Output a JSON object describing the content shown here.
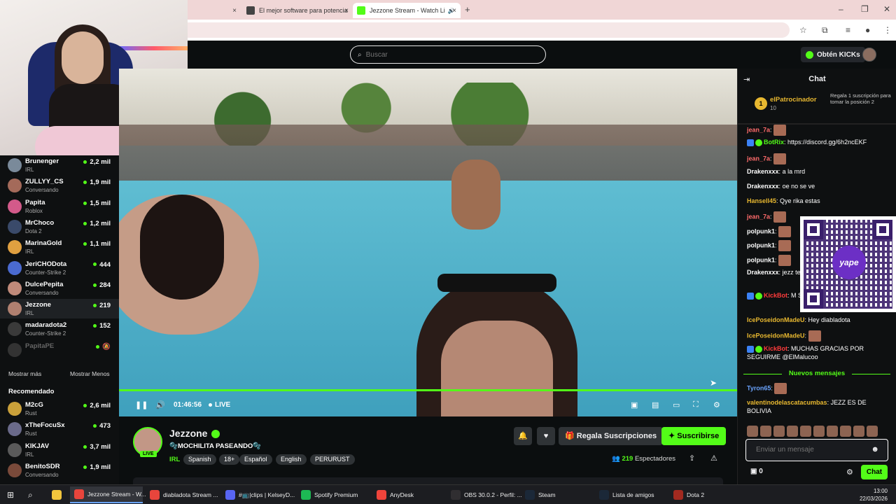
{
  "browser": {
    "tabs": [
      {
        "label": "",
        "active": false
      },
      {
        "label": "El mejor software para potencia",
        "active": false
      },
      {
        "label": "Jezzone Stream - Watch Li",
        "active": true
      }
    ],
    "new_tab": "+",
    "close": "×"
  },
  "header": {
    "search_placeholder": "Buscar",
    "get_kicks": "Obtén KICKs"
  },
  "sidebar": {
    "channels": [
      {
        "name": "Brunenger",
        "category": "IRL",
        "viewers": "2,2 mil",
        "color": "#7a8a9a"
      },
      {
        "name": "ZULLYY_CS",
        "category": "Conversando",
        "viewers": "1,9 mil",
        "color": "#a46a5a"
      },
      {
        "name": "Papita",
        "category": "Roblox",
        "viewers": "1,5 mil",
        "color": "#d35a8a"
      },
      {
        "name": "MrChoco",
        "category": "Dota 2",
        "viewers": "1,2 mil",
        "color": "#3a4a6a"
      },
      {
        "name": "MarinaGold",
        "category": "IRL",
        "viewers": "1,1 mil",
        "color": "#e0a040"
      },
      {
        "name": "JeriCHODota",
        "category": "Counter-Strike 2",
        "viewers": "444",
        "color": "#4a6ad0"
      },
      {
        "name": "DulcePepita",
        "category": "Conversando",
        "viewers": "284",
        "color": "#c08a7a"
      },
      {
        "name": "Jezzone",
        "category": "IRL",
        "viewers": "219",
        "color": "#b08070"
      },
      {
        "name": "madaradota2",
        "category": "Counter-Strike 2",
        "viewers": "152",
        "color": "#3a3a3a"
      },
      {
        "name": "PapitaPE",
        "category": "",
        "viewers": "",
        "color": "#333"
      }
    ],
    "show_more": "Mostrar más",
    "show_less": "Mostrar Menos",
    "recommended_title": "Recomendado",
    "recommended": [
      {
        "name": "M2cG",
        "category": "Rust",
        "viewers": "2,6 mil",
        "color": "#c9a03a"
      },
      {
        "name": "xTheFocuSx",
        "category": "Rust",
        "viewers": "473",
        "color": "#6a6a8a"
      },
      {
        "name": "KIKJAV",
        "category": "IRL",
        "viewers": "3,7 mil",
        "color": "#5a5a5a"
      },
      {
        "name": "BenitoSDR",
        "category": "Conversando",
        "viewers": "1,9 mil",
        "color": "#7a4a3a"
      }
    ]
  },
  "player": {
    "time": "01:46:56",
    "live": "LIVE"
  },
  "stream": {
    "name": "Jezzone",
    "live_tag": "LIVE",
    "title": "🫧MOCHILITA PASEANDO🫧",
    "category": "IRL",
    "tags": [
      "Spanish",
      "18+",
      "Español",
      "English",
      "PERURUST"
    ],
    "gift_label": "Regala Suscripciones",
    "subscribe_label": "Suscribirse",
    "viewers": "219",
    "viewers_label": "Espectadores"
  },
  "chat": {
    "title": "Chat",
    "pinned": {
      "rank": "1",
      "name": "elPatrocinador",
      "count": "10",
      "text": "Regala 1 suscripción para tomar la posición 2"
    },
    "messages": [
      {
        "user": "jean_7a",
        "text": "",
        "color": "#ff6b6b",
        "emote": true
      },
      {
        "user": "BotRix",
        "text": "https://discord.gg/6h2ncEKF",
        "color": "#53fc18",
        "badges": true
      },
      {
        "user": "jean_7a",
        "text": "",
        "color": "#ff6b6b",
        "emote": true
      },
      {
        "user": "Drakenxxx",
        "text": "a la mrd",
        "color": "#ffffff"
      },
      {
        "user": "Drakenxxx",
        "text": "oe no se ve",
        "color": "#ffffff"
      },
      {
        "user": "Hansell45",
        "text": "Qye rika estas",
        "color": "#e8b830"
      },
      {
        "user": "jean_7a",
        "text": "",
        "color": "#ff6b6b",
        "emote": true
      },
      {
        "user": "polpunk1",
        "text": "",
        "color": "#ffffff",
        "emote": true
      },
      {
        "user": "polpunk1",
        "text": "",
        "color": "#ffffff",
        "emote": true
      },
      {
        "user": "polpunk1",
        "text": "",
        "color": "#ffffff",
        "emote": true
      },
      {
        "user": "Drakenxxx",
        "text": "jezz te costado se orinó e",
        "color": "#ffffff"
      },
      {
        "user": "KickBot",
        "text": "M SEGUIRME @IcePo",
        "color": "#ff3b3b",
        "badges": true
      },
      {
        "user": "IcePoseidonMadeU",
        "text": "Hey diabladota",
        "color": "#e8b830"
      },
      {
        "user": "IcePoseidonMadeU",
        "text": "",
        "color": "#e8b830",
        "emote": true
      },
      {
        "user": "KickBot",
        "text": "MUCHAS GRACIAS POR SEGUIRME @ElMalucoo",
        "color": "#ff3b3b",
        "badges": true
      }
    ],
    "new_messages": "Nuevos mensajes",
    "after_new": [
      {
        "user": "Tyron65",
        "text": "",
        "color": "#6aa4ff",
        "emote": true
      },
      {
        "user": "valentinodelascatacumbas",
        "text": "JEZZ ES DE BOLIVIA",
        "color": "#e8b830"
      }
    ],
    "input_placeholder": "Enviar un mensaje",
    "kicks_balance": "0",
    "send_label": "Chat"
  },
  "qr": {
    "brand": "yape"
  },
  "taskbar": {
    "items": [
      {
        "label": "Jezzone Stream - W...",
        "color": "#e8453c",
        "active": true
      },
      {
        "label": "diabladota Stream ...",
        "color": "#e8453c",
        "active": false
      },
      {
        "label": "#📺|clips | KelseyD...",
        "color": "#5865f2",
        "active": false
      },
      {
        "label": "Spotify Premium",
        "color": "#1db954",
        "active": false
      },
      {
        "label": "AnyDesk",
        "color": "#ef443b",
        "active": false
      },
      {
        "label": "OBS 30.0.2 - Perfil: ...",
        "color": "#302e31",
        "active": false
      },
      {
        "label": "Steam",
        "color": "#1b2838",
        "active": false
      },
      {
        "label": "Lista de amigos",
        "color": "#1b2838",
        "active": false
      },
      {
        "label": "Dota 2",
        "color": "#a22a20",
        "active": false
      }
    ],
    "time": "13:00",
    "date": "22/03/2026"
  }
}
